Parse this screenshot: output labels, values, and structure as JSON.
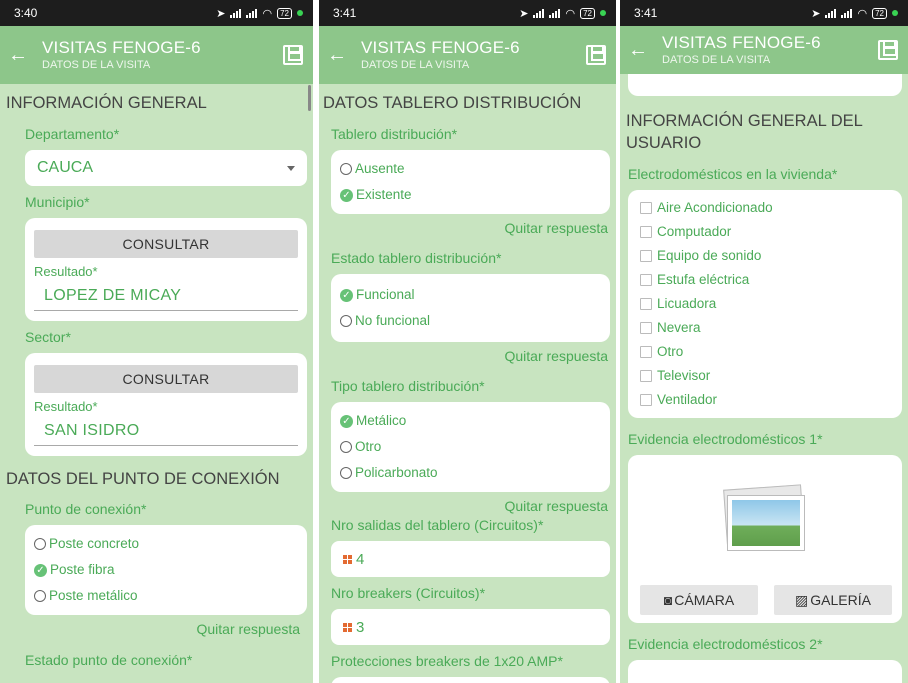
{
  "panel1": {
    "time": "3:40",
    "battery": "72",
    "header": {
      "title": "VISITAS FENOGE-6",
      "subtitle": "DATOS DE LA VISITA"
    },
    "section_general": "INFORMACIÓN GENERAL",
    "departamento": {
      "label": "Departamento*",
      "value": "CAUCA"
    },
    "municipio": {
      "label": "Municipio*",
      "button": "CONSULTAR",
      "result_label": "Resultado*",
      "result_value": "LOPEZ DE MICAY"
    },
    "sector": {
      "label": "Sector*",
      "button": "CONSULTAR",
      "result_label": "Resultado*",
      "result_value": "SAN ISIDRO"
    },
    "section_conexion": "DATOS DEL PUNTO DE CONEXIÓN",
    "punto_conexion": {
      "label": "Punto de conexión*",
      "options": [
        "Poste concreto",
        "Poste fibra",
        "Poste metálico"
      ],
      "selected": "Poste fibra",
      "clear": "Quitar respuesta"
    },
    "estado_label": "Estado punto de conexión*"
  },
  "panel2": {
    "time": "3:41",
    "battery": "72",
    "header": {
      "title": "VISITAS FENOGE-6",
      "subtitle": "DATOS DE LA VISITA"
    },
    "section": "DATOS TABLERO DISTRIBUCIÓN",
    "tablero": {
      "label": "Tablero distribución*",
      "options": [
        "Ausente",
        "Existente"
      ],
      "selected": "Existente",
      "clear": "Quitar respuesta"
    },
    "estado": {
      "label": "Estado tablero distribución*",
      "options": [
        "Funcional",
        "No funcional"
      ],
      "selected": "Funcional",
      "clear": "Quitar respuesta"
    },
    "tipo": {
      "label": "Tipo tablero distribución*",
      "options": [
        "Metálico",
        "Otro",
        "Policarbonato"
      ],
      "selected": "Metálico",
      "clear": "Quitar respuesta"
    },
    "salidas": {
      "label": "Nro salidas del tablero (Circuitos)*",
      "value": "4"
    },
    "breakers": {
      "label": "Nro breakers (Circuitos)*",
      "value": "3"
    },
    "protecciones_label": "Protecciones breakers de 1x20 AMP*"
  },
  "panel3": {
    "time": "3:41",
    "battery": "72",
    "header": {
      "title": "VISITAS FENOGE-6",
      "subtitle": "DATOS DE LA VISITA"
    },
    "section": "INFORMACIÓN GENERAL DEL USUARIO",
    "electro": {
      "label": "Electrodomésticos en la vivienda*",
      "options": [
        "Aire Acondicionado",
        "Computador",
        "Equipo de sonido",
        "Estufa eléctrica",
        "Licuadora",
        "Nevera",
        "Otro",
        "Televisor",
        "Ventilador"
      ]
    },
    "evidencia1": {
      "label": "Evidencia electrodomésticos 1*",
      "camera": "CÁMARA",
      "gallery": "GALERÍA"
    },
    "evidencia2_label": "Evidencia electrodomésticos 2*"
  }
}
